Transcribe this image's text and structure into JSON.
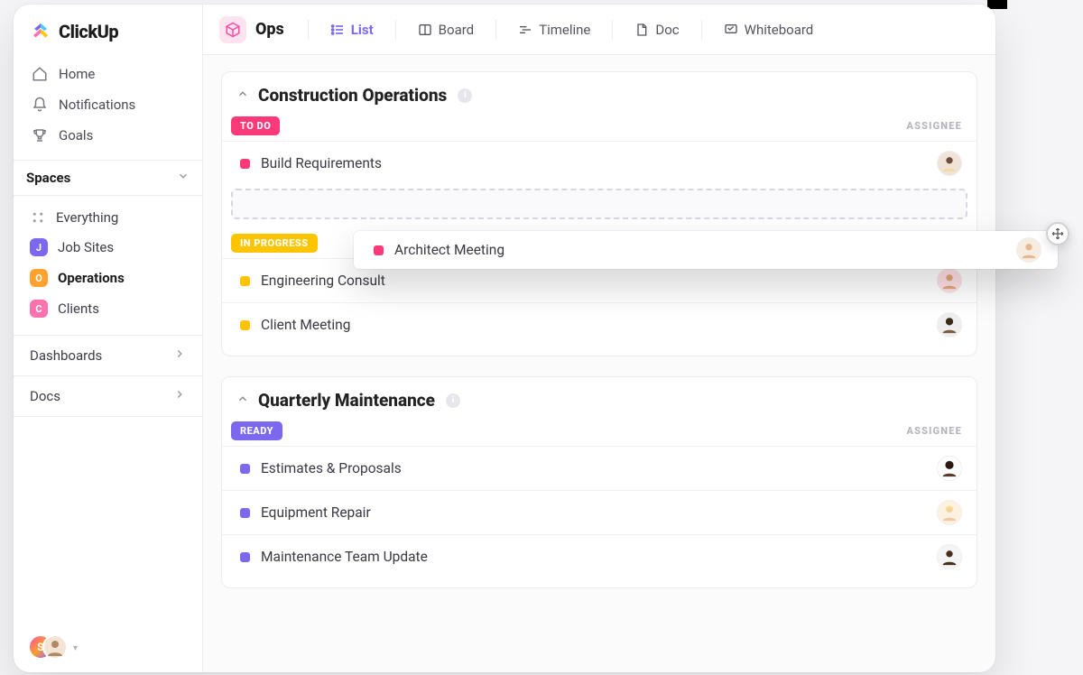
{
  "brand": {
    "name": "ClickUp"
  },
  "sidebar": {
    "nav": [
      {
        "label": "Home",
        "icon": "home"
      },
      {
        "label": "Notifications",
        "icon": "bell"
      },
      {
        "label": "Goals",
        "icon": "trophy"
      }
    ],
    "spaces_header": "Spaces",
    "everything_label": "Everything",
    "spaces": [
      {
        "initial": "J",
        "label": "Job Sites",
        "color": "purple"
      },
      {
        "initial": "O",
        "label": "Operations",
        "color": "orange",
        "active": true
      },
      {
        "initial": "C",
        "label": "Clients",
        "color": "pink"
      }
    ],
    "sections": [
      {
        "label": "Dashboards"
      },
      {
        "label": "Docs"
      }
    ],
    "user_initial": "S"
  },
  "topbar": {
    "space_label": "Ops",
    "views": [
      {
        "label": "List",
        "icon": "list",
        "active": true
      },
      {
        "label": "Board",
        "icon": "board"
      },
      {
        "label": "Timeline",
        "icon": "timeline"
      },
      {
        "label": "Doc",
        "icon": "doc"
      },
      {
        "label": "Whiteboard",
        "icon": "whiteboard"
      }
    ]
  },
  "groups": [
    {
      "title": "Construction Operations",
      "assignee_label": "ASSIGNEE",
      "sections": [
        {
          "status": "TO DO",
          "pill": "pink",
          "tasks": [
            {
              "title": "Build Requirements",
              "square": "pink",
              "avatar": "a1"
            }
          ],
          "dropzone": true
        },
        {
          "status": "IN PROGRESS",
          "pill": "amber",
          "tasks": [
            {
              "title": "Engineering Consult",
              "square": "amber",
              "avatar": "a2"
            },
            {
              "title": "Client Meeting",
              "square": "amber",
              "avatar": "a3"
            }
          ]
        }
      ]
    },
    {
      "title": "Quarterly Maintenance",
      "assignee_label": "ASSIGNEE",
      "sections": [
        {
          "status": "READY",
          "pill": "indigo",
          "tasks": [
            {
              "title": "Estimates & Proposals",
              "square": "indigo",
              "avatar": "a4"
            },
            {
              "title": "Equipment Repair",
              "square": "indigo",
              "avatar": "a5"
            },
            {
              "title": "Maintenance Team Update",
              "square": "indigo",
              "avatar": "a6"
            }
          ]
        }
      ]
    }
  ],
  "dragged_task": {
    "title": "Architect Meeting",
    "square": "pink",
    "avatar": "a7"
  }
}
